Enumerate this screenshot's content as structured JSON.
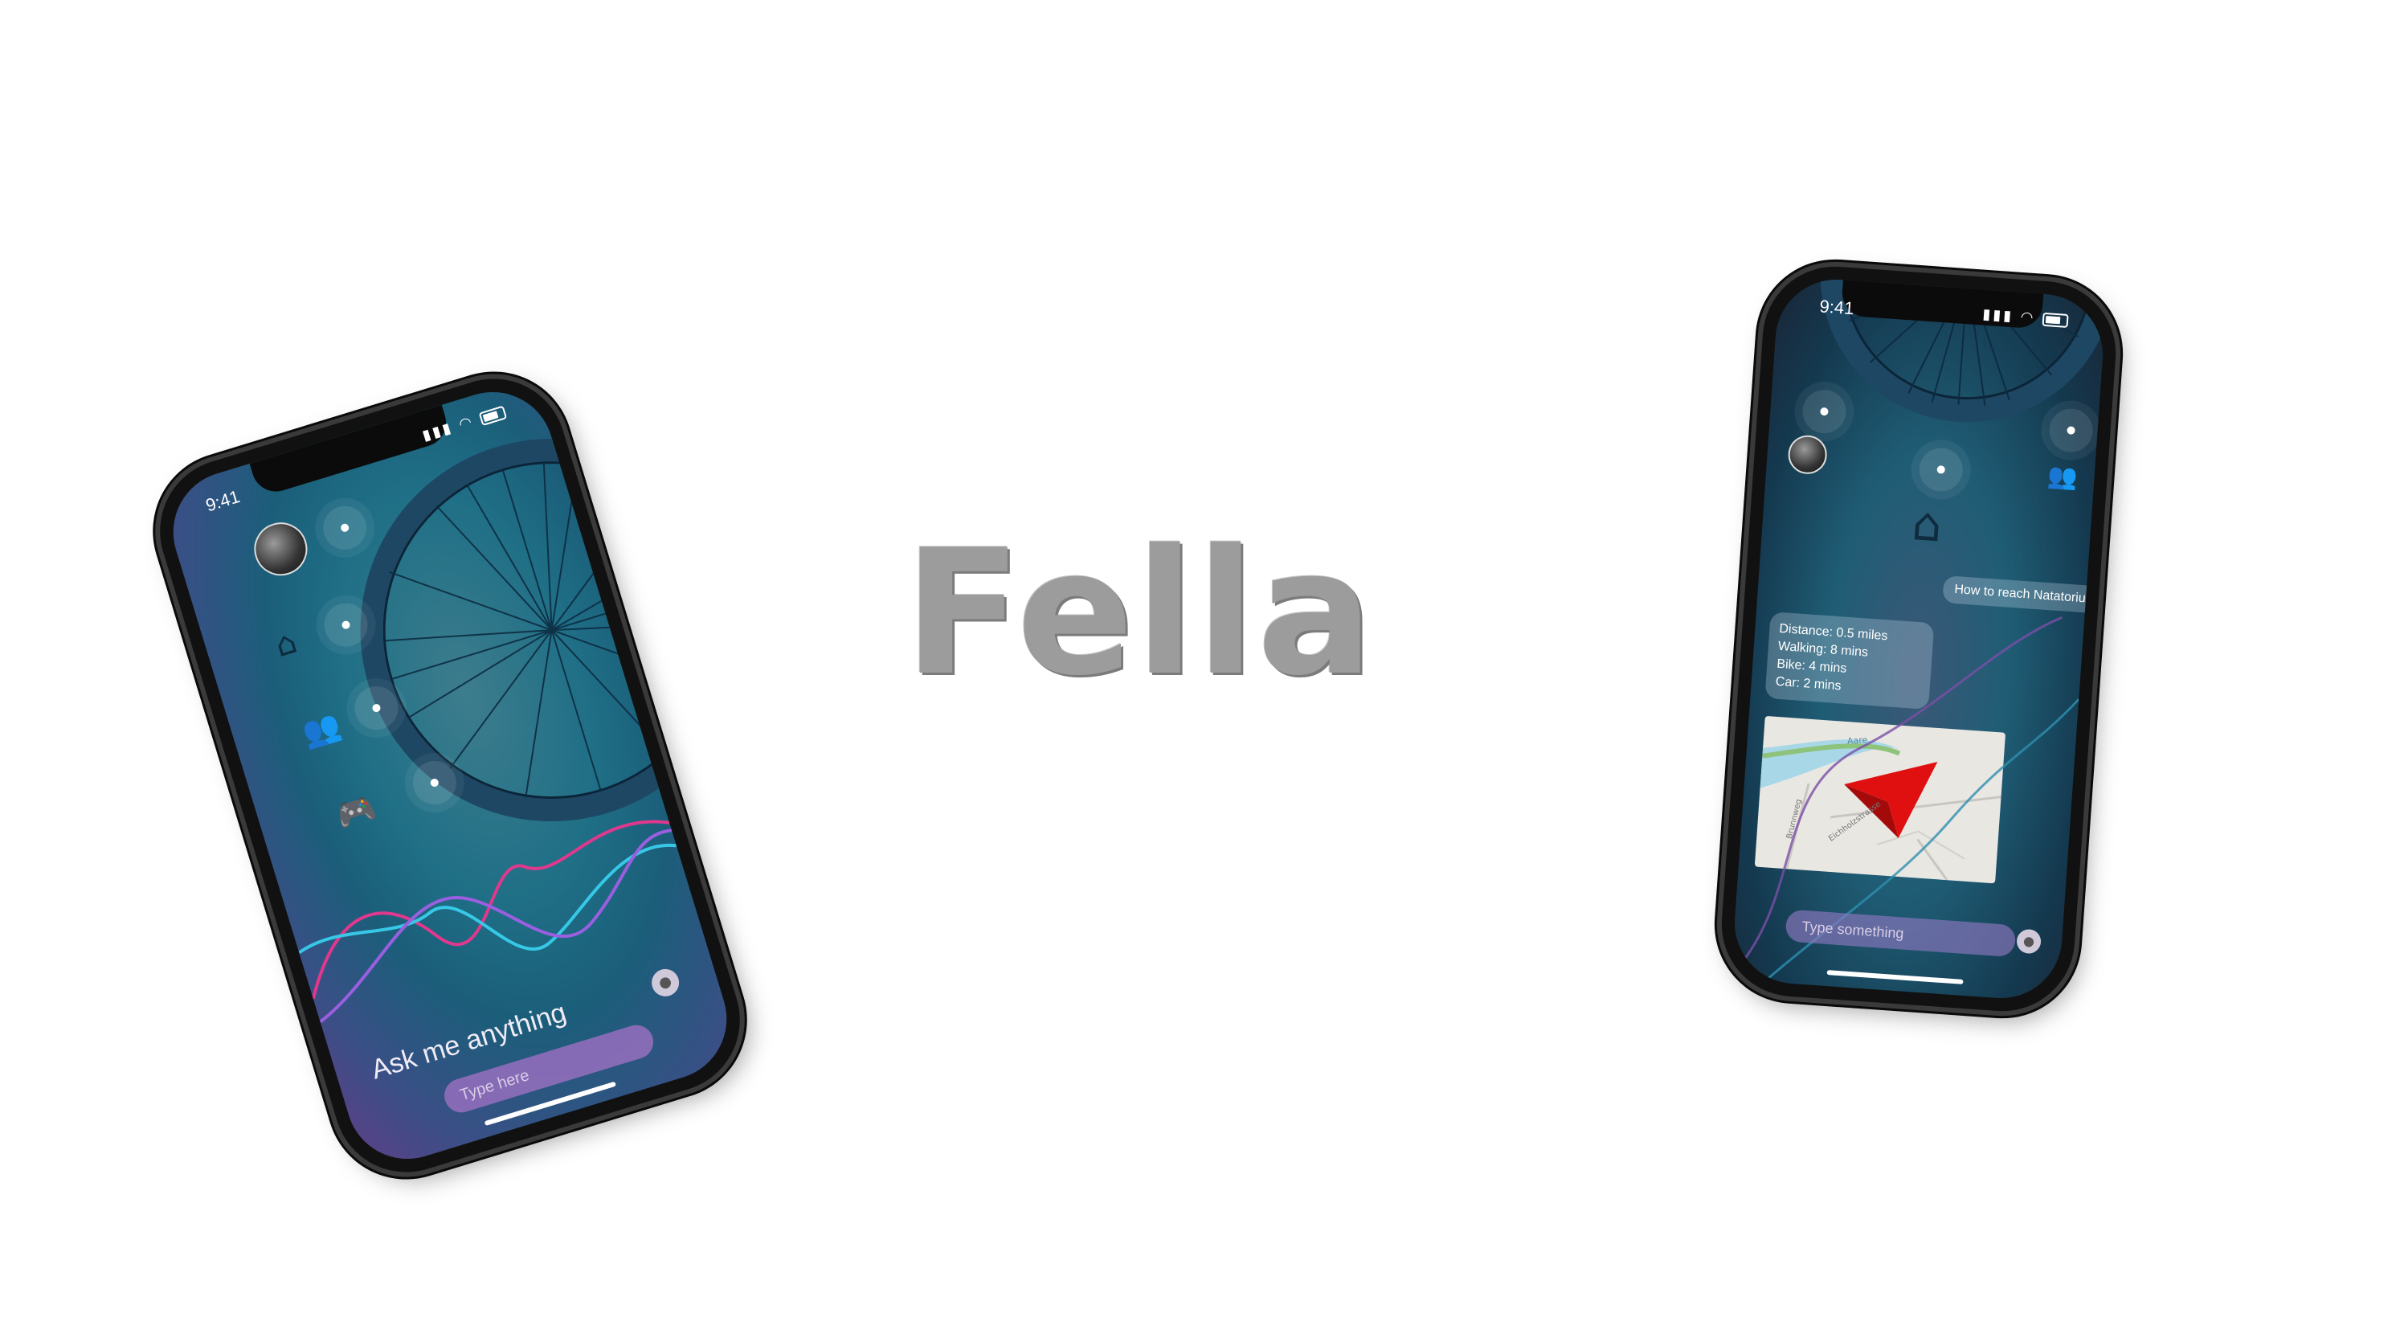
{
  "title": "Fella",
  "phone_left": {
    "status_time": "9:41",
    "prompt": "Ask me anything",
    "input_placeholder": "Type here",
    "icons": [
      "avatar",
      "home-icon",
      "people-icon",
      "gamepad-icon",
      "mic-icon"
    ]
  },
  "phone_right": {
    "status_time": "9:41",
    "user_message": "How to reach Natatorium",
    "reply_lines": [
      "Distance: 0.5 miles",
      "Walking: 8 mins",
      "Bike: 4 mins",
      "Car: 2 mins"
    ],
    "input_placeholder": "Type something",
    "map_labels": [
      "Aare",
      "Brunnweg",
      "Eichholzstrasse"
    ],
    "icons": [
      "avatar",
      "home-icon",
      "people-icon",
      "navigation-arrow-icon",
      "mic-icon"
    ]
  },
  "colors": {
    "title": "#9c9c9c",
    "screen_teal": "#1f6f86",
    "screen_purple": "#5d3f86",
    "wave_pink": "#e0388c",
    "wave_cyan": "#36c8e6",
    "wave_violet": "#9a5fe0",
    "map_arrow": "#e01010"
  }
}
